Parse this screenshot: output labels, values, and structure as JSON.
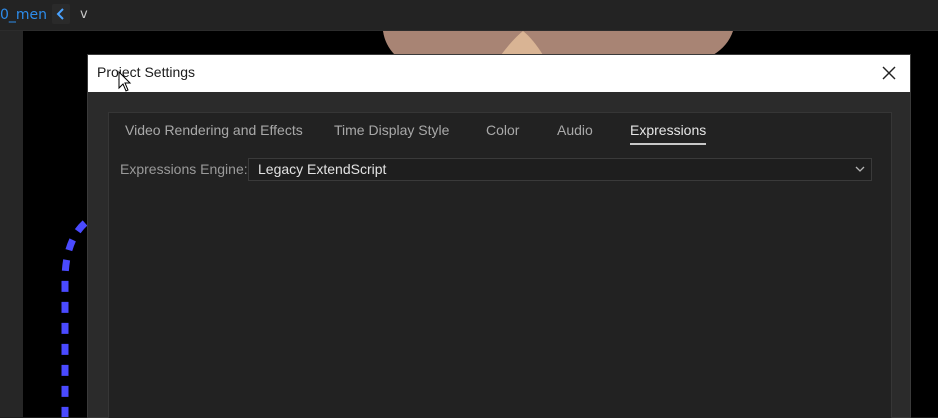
{
  "app": {
    "comp_tab": "0_men",
    "nav_icon": "chevron-left-icon",
    "view_label": "v"
  },
  "dialog": {
    "title": "Project Settings",
    "close_icon": "close-icon",
    "tabs": [
      {
        "label": "Video Rendering and Effects",
        "active": false
      },
      {
        "label": "Time Display Style",
        "active": false
      },
      {
        "label": "Color",
        "active": false
      },
      {
        "label": "Audio",
        "active": false
      },
      {
        "label": "Expressions",
        "active": true
      }
    ],
    "expressions": {
      "engine_label": "Expressions Engine:",
      "engine_value": "Legacy ExtendScript",
      "dropdown_icon": "chevron-down-icon"
    }
  },
  "colors": {
    "accent_blue": "#2d8ceb",
    "dashed_path": "#4a4aff"
  }
}
